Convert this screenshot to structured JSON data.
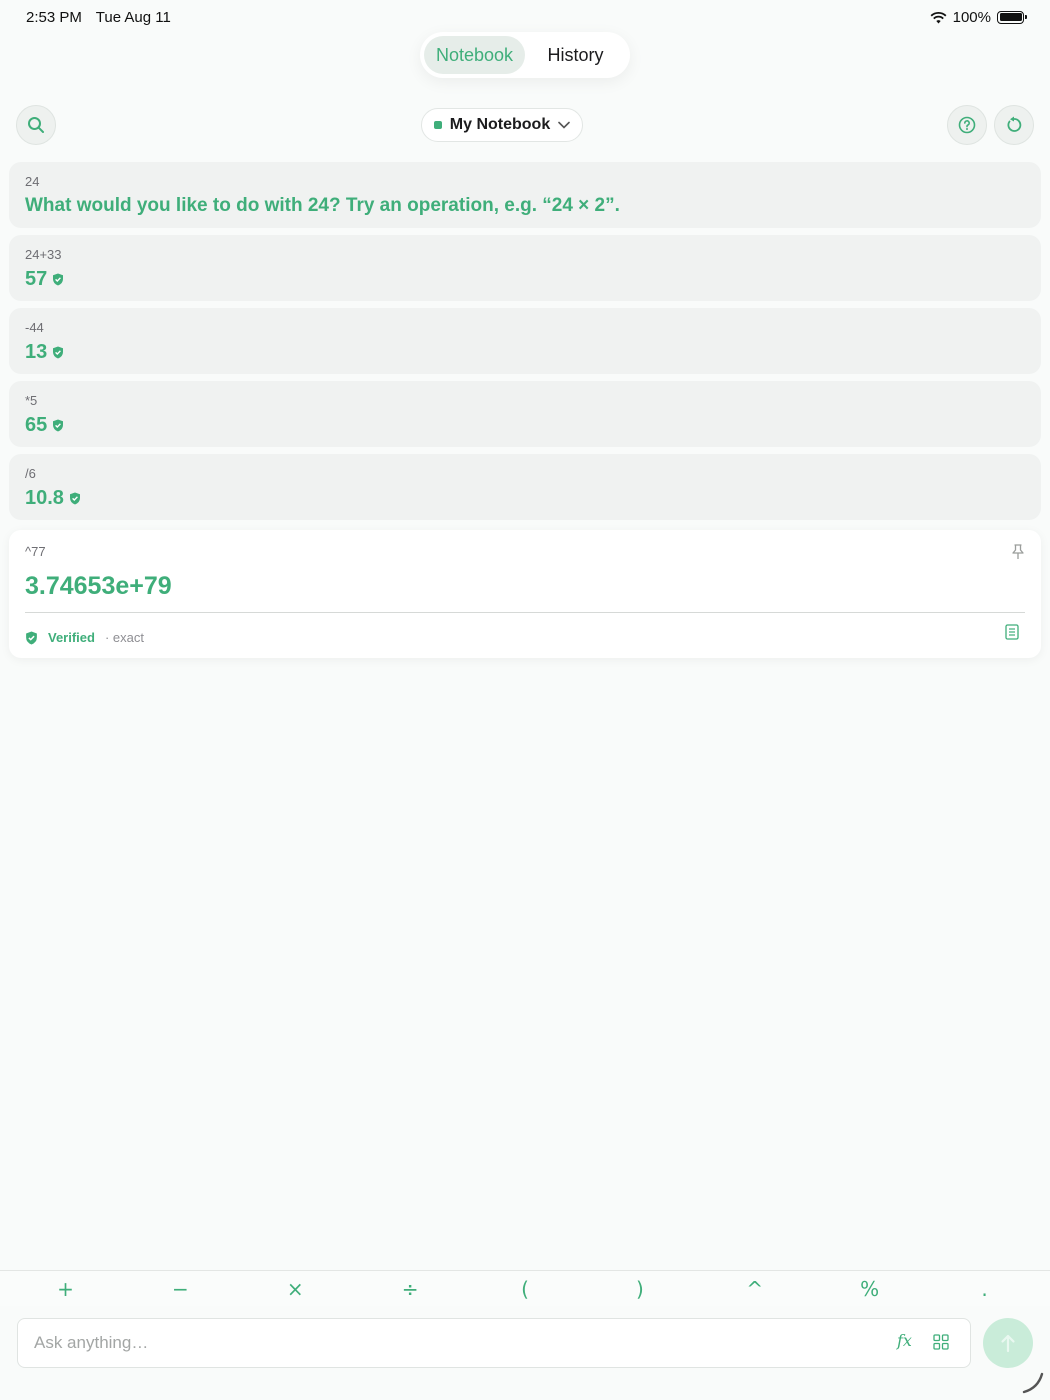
{
  "status_bar": {
    "time": "2:53 PM",
    "date": "Tue Aug 11",
    "battery": "100%"
  },
  "tabs": [
    {
      "label": "Notebook",
      "active": true
    },
    {
      "label": "History",
      "active": false
    }
  ],
  "toolbar": {
    "notebook_name": "My Notebook",
    "search_icon": "search-icon",
    "help_icon": "help-icon",
    "reset_icon": "reset-icon"
  },
  "cards": [
    {
      "expr": "24",
      "result": "What would you like to do with 24? Try an operation, e.g. “24 × 2”.",
      "verified": false
    },
    {
      "expr": "24+33",
      "result": "57",
      "verified": true
    },
    {
      "expr": "-44",
      "result": "13",
      "verified": true
    },
    {
      "expr": "*5",
      "result": "65",
      "verified": true
    },
    {
      "expr": "/6",
      "result": "10.8",
      "verified": true
    }
  ],
  "active_card": {
    "expr": "^77",
    "result": "3.74653e+79",
    "verified_label": "Verified",
    "exact_label": "· exact"
  },
  "operators": [
    "+",
    "−",
    "×",
    "÷",
    "(",
    ")",
    "^",
    "%",
    "."
  ],
  "input": {
    "placeholder": "Ask anything…",
    "value": "",
    "fx_label": "𝑓x"
  },
  "colors": {
    "accent": "#3fae7a",
    "background": "#f9fbfa",
    "card": "#f0f2f1"
  }
}
